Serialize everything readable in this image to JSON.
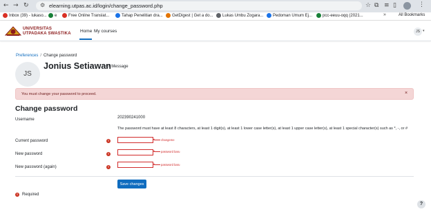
{
  "browser": {
    "url": "elearning.utpas.ac.id/login/change_password.php",
    "bookmarks": [
      {
        "label": "Inbox (39) - lukaso...",
        "color": "#d93025"
      },
      {
        "label": "e",
        "color": "#188038"
      },
      {
        "label": "Free Online Translat...",
        "color": "#d93025"
      },
      {
        "label": "Tahap Penelitian dra...",
        "color": "#1a73e8"
      },
      {
        "label": "GetDigest | Get a do...",
        "color": "#e37400"
      },
      {
        "label": "Lukas Umbu Zogara...",
        "color": "#5f6368"
      },
      {
        "label": "Pedoman Umum Ej...",
        "color": "#1a73e8"
      },
      {
        "label": "pcc-eeuu-oqq (2021...",
        "color": "#188038"
      }
    ],
    "more_label": "»",
    "all_bookmarks_label": "All Bookmarks"
  },
  "site": {
    "logo_line1": "UNIVERSITAS",
    "logo_line2": "UTPADAKA SWASTIKA",
    "nav": {
      "home": "Home",
      "my_courses": "My courses"
    },
    "user_initials": "JS"
  },
  "breadcrumb": {
    "parent": "Preferences",
    "separator": "/",
    "current": "Change password"
  },
  "profile": {
    "initials": "JS",
    "name": "Jonius Setiawan",
    "message_label": "Message"
  },
  "alert": {
    "text": "You must change your password to proceed.",
    "close": "×"
  },
  "form": {
    "title": "Change password",
    "username_label": "Username",
    "username_value": "202390241000",
    "policy_text": "The password must have at least 8 characters, at least 1 digit(s), at least 1 lower case letter(s), at least 1 upper case letter(s), at least 1 special character(s) such as *, -, or #",
    "current_label": "Current password",
    "new_label": "New password",
    "new_again_label": "New password (again)",
    "annotations": {
      "current": "changeme",
      "new": "password baru",
      "new_again": "password baru"
    },
    "submit_label": "Save changes",
    "required_label": "Required"
  },
  "help": {
    "label": "?"
  },
  "colors": {
    "primary": "#0f6cbf",
    "danger": "#ca3120",
    "alert_bg": "#f4d6d6",
    "brand": "#8b1a1a"
  }
}
